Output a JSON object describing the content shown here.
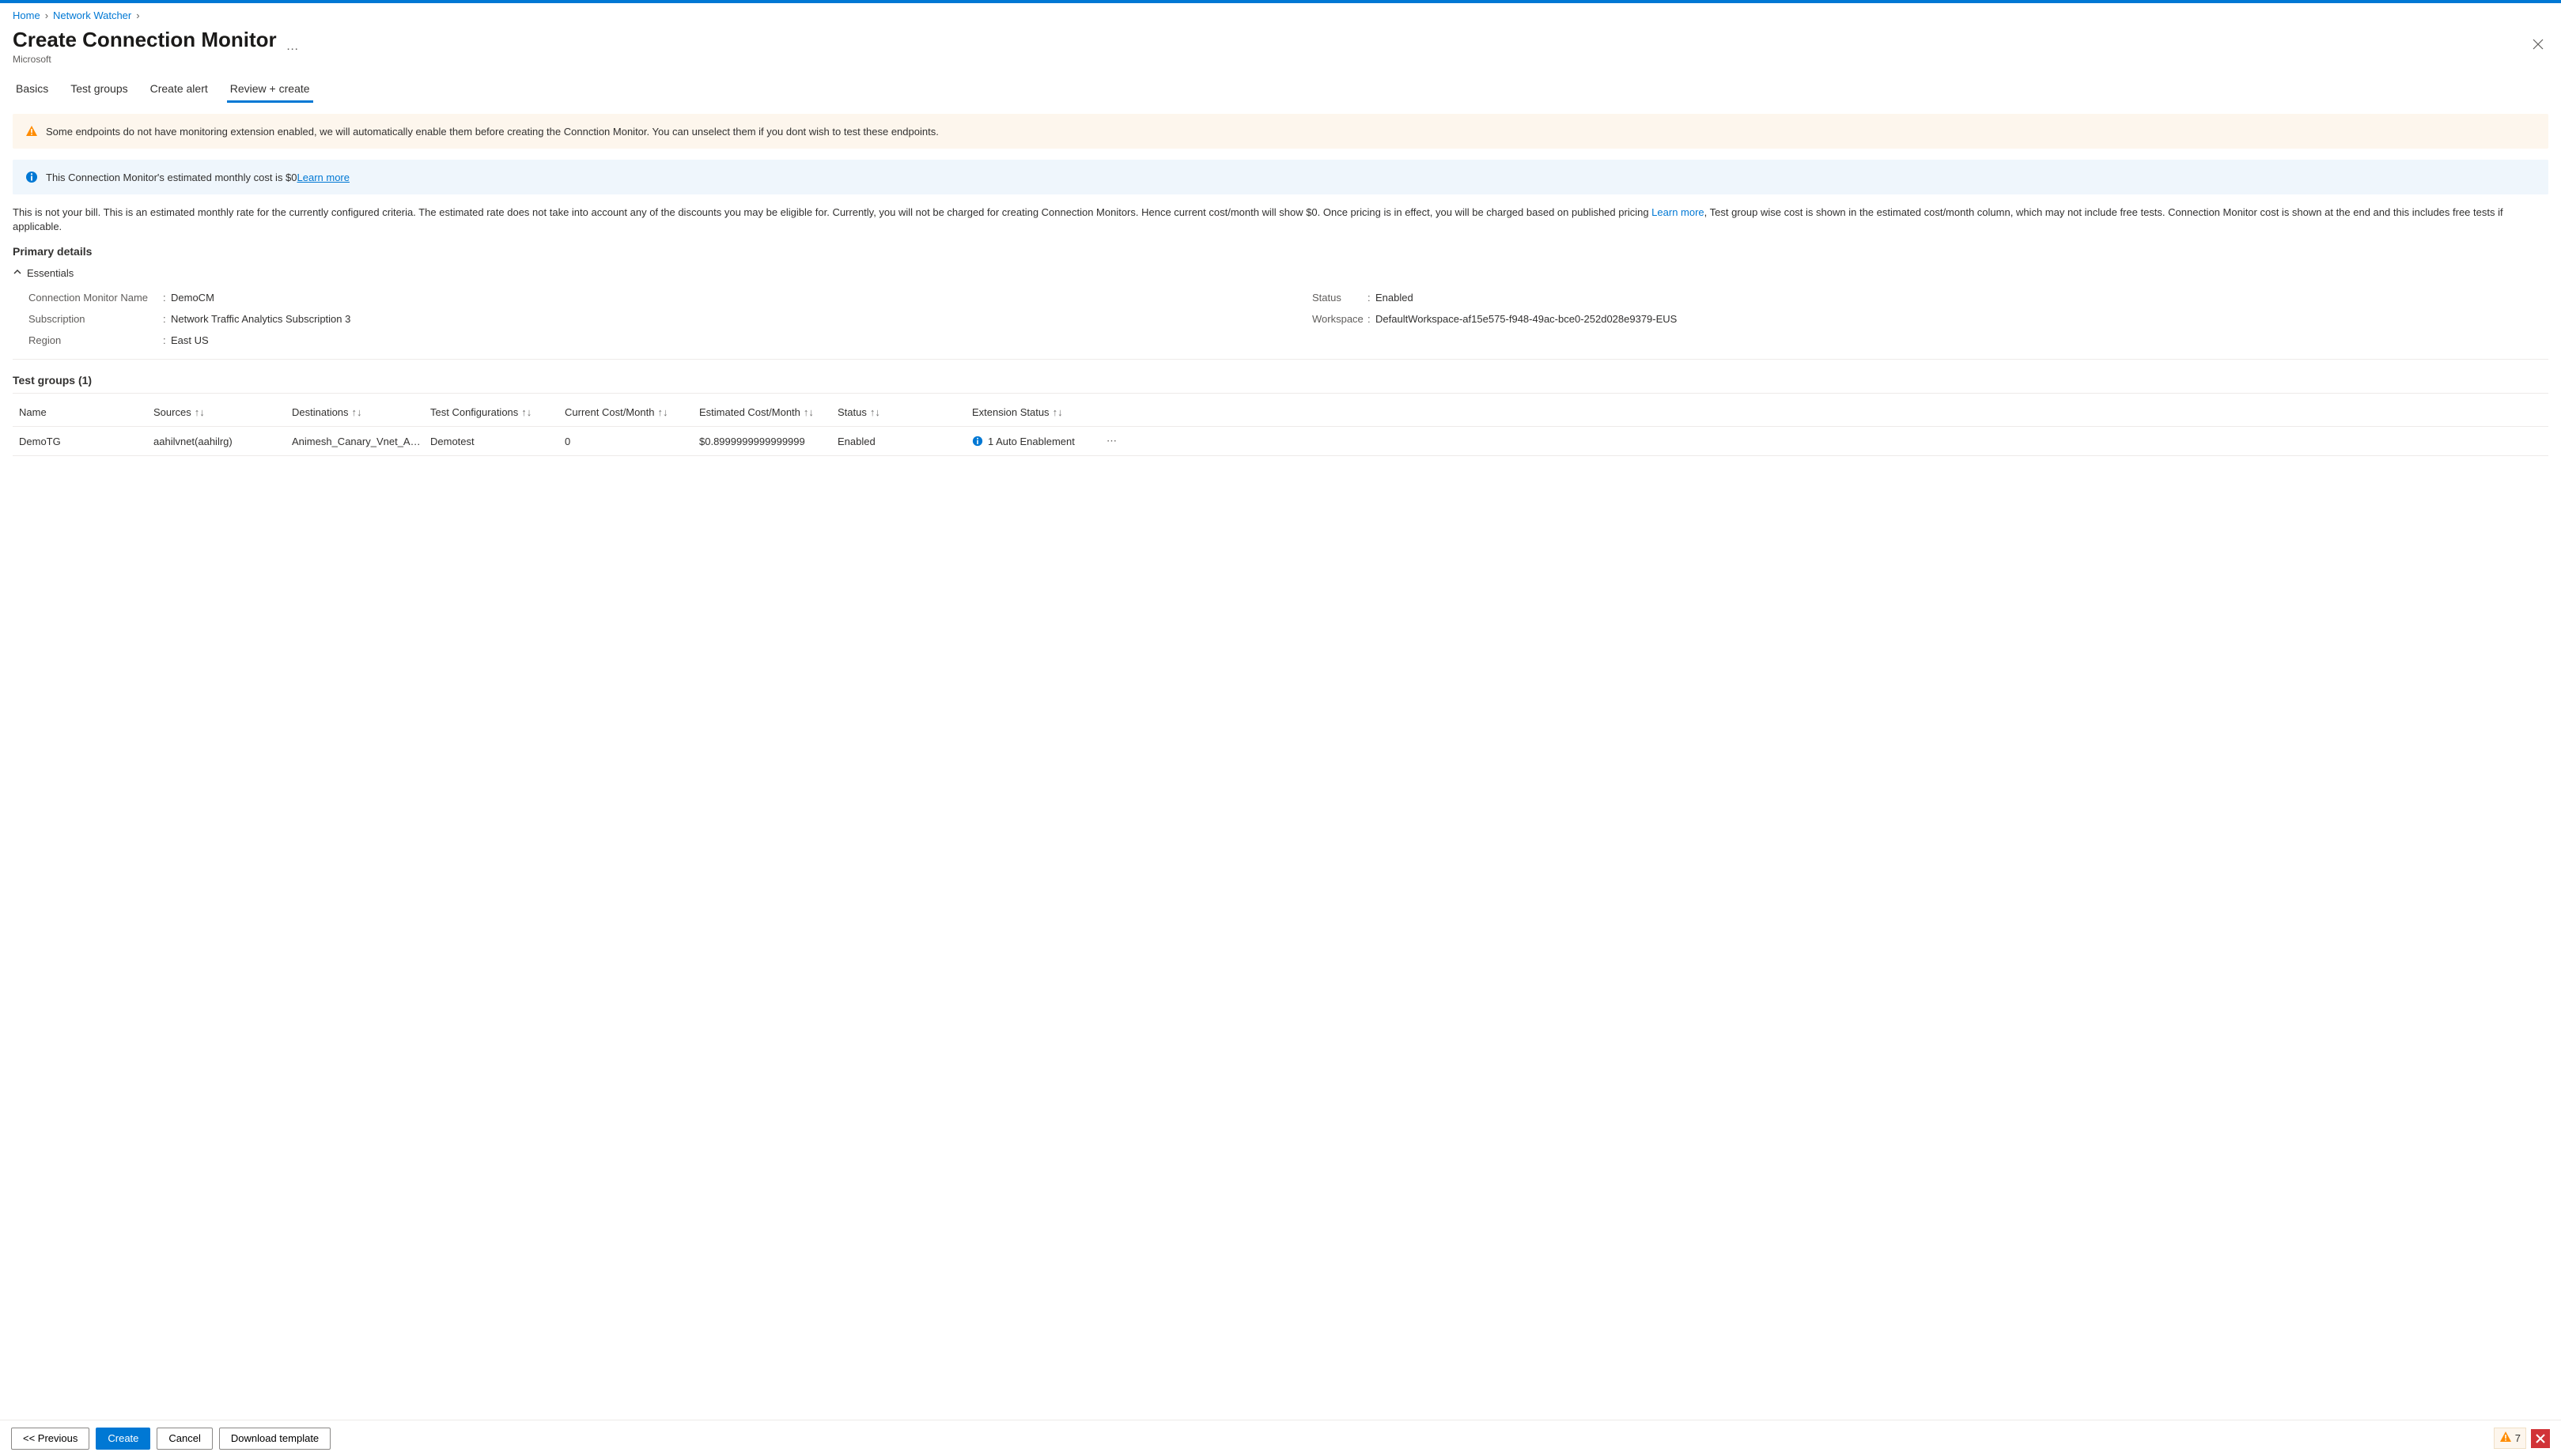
{
  "breadcrumb": [
    {
      "label": "Home"
    },
    {
      "label": "Network Watcher"
    }
  ],
  "header": {
    "title": "Create Connection Monitor",
    "subtitle": "Microsoft"
  },
  "tabs": [
    {
      "label": "Basics",
      "active": false
    },
    {
      "label": "Test groups",
      "active": false
    },
    {
      "label": "Create alert",
      "active": false
    },
    {
      "label": "Review + create",
      "active": true
    }
  ],
  "banner_warn": "Some endpoints do not have monitoring extension enabled, we will automatically enable them before creating the Connction Monitor. You can unselect them if you dont wish to test these endpoints.",
  "banner_info_prefix": "This Connection Monitor's estimated monthly cost is $0",
  "banner_info_link": "Learn more",
  "disclaimer_prefix": "This is not your bill. This is an estimated monthly rate for the currently configured criteria. The estimated rate does not take into account any of the discounts you may be eligible for. Currently, you will not be charged for creating Connection Monitors. Hence current cost/month will show $0. Once pricing is in effect, you will be charged based on published pricing ",
  "disclaimer_link": "Learn more",
  "disclaimer_suffix": ", Test group wise cost is shown in the estimated cost/month column, which may not include free tests. Connection Monitor cost is shown at the end and this includes free tests if applicable.",
  "primary_details_title": "Primary details",
  "essentials_label": "Essentials",
  "essentials": {
    "left": [
      {
        "label": "Connection Monitor Name",
        "value": "DemoCM"
      },
      {
        "label": "Subscription",
        "value": "Network Traffic Analytics Subscription 3"
      },
      {
        "label": "Region",
        "value": "East US"
      }
    ],
    "right": [
      {
        "label": "Status",
        "value": "Enabled"
      },
      {
        "label": "Workspace",
        "value": "DefaultWorkspace-af15e575-f948-49ac-bce0-252d028e9379-EUS"
      }
    ]
  },
  "test_groups_title": "Test groups (1)",
  "columns": {
    "name": "Name",
    "sources": "Sources",
    "destinations": "Destinations",
    "test_configs": "Test Configurations",
    "current_cost": "Current Cost/Month",
    "estimated_cost": "Estimated Cost/Month",
    "status": "Status",
    "ext_status": "Extension Status"
  },
  "rows": [
    {
      "name": "DemoTG",
      "sources": "aahilvnet(aahilrg)",
      "destinations": "Animesh_Canary_Vnet_ANM(...",
      "test_configs": "Demotest",
      "current_cost": "0",
      "estimated_cost": "$0.8999999999999999",
      "status": "Enabled",
      "ext_status": "1 Auto Enablement"
    }
  ],
  "footer": {
    "previous": "<< Previous",
    "create": "Create",
    "cancel": "Cancel",
    "download": "Download template",
    "warn_count": "7"
  }
}
